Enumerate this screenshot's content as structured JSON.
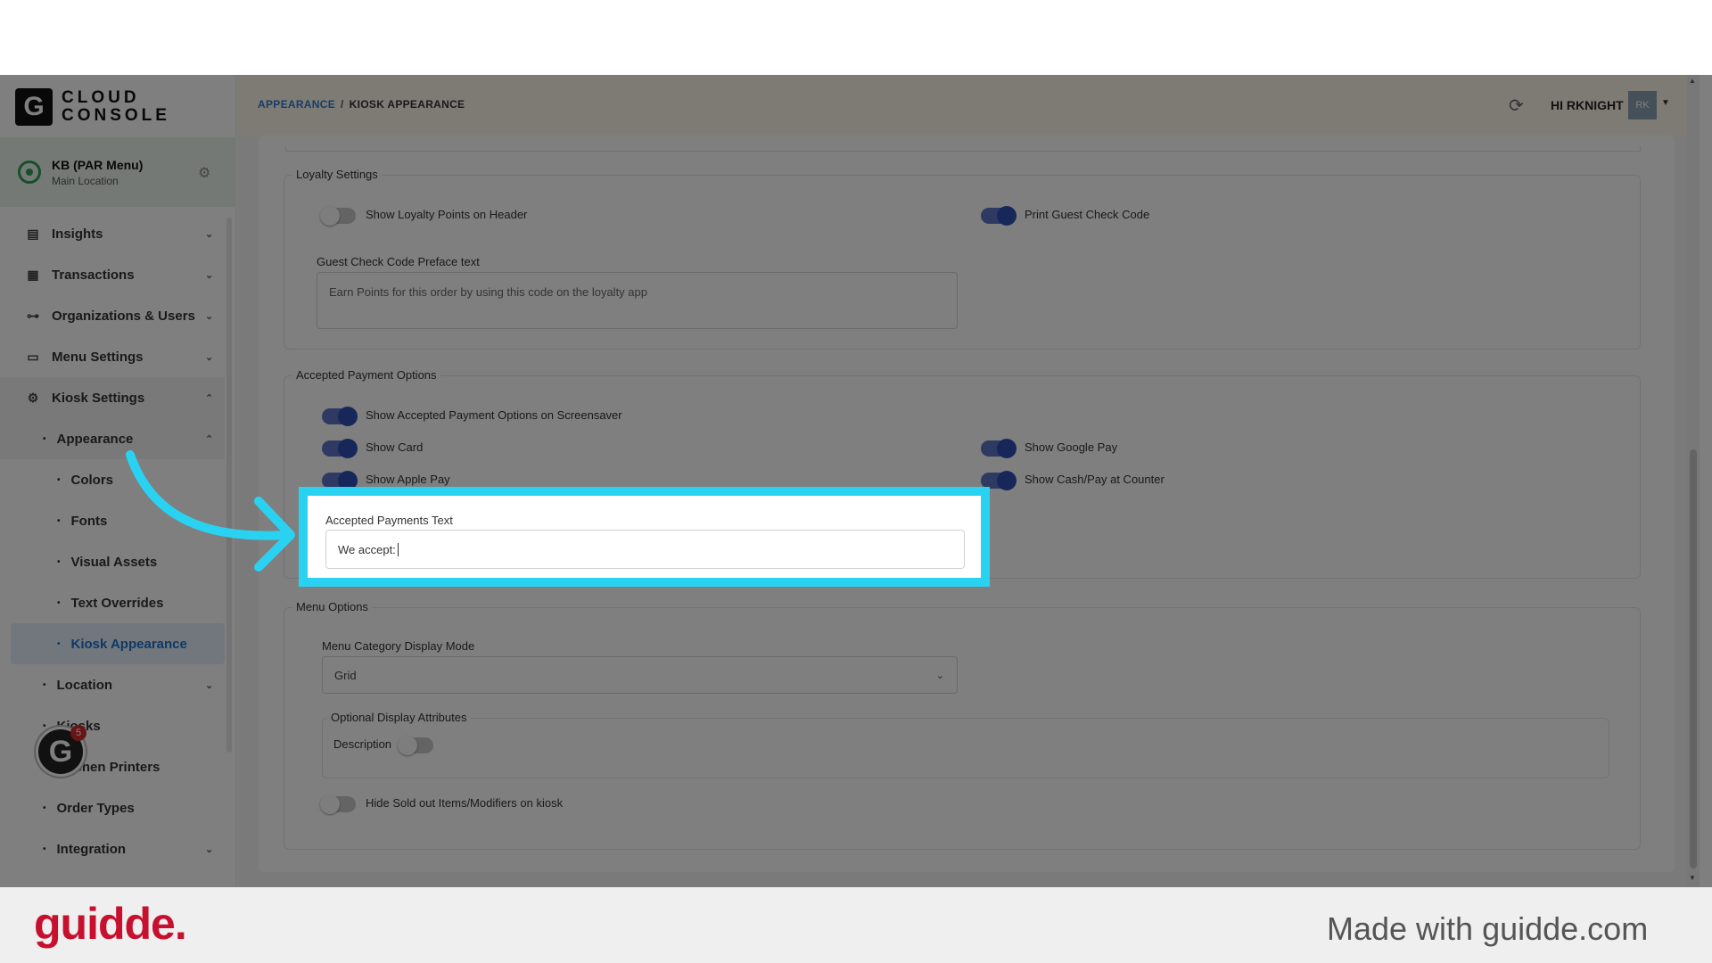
{
  "logo": {
    "letter": "G",
    "line1": "CLOUD",
    "line2": "CONSOLE"
  },
  "location": {
    "name": "KB (PAR Menu)",
    "sub": "Main Location"
  },
  "nav": {
    "items": [
      "Insights",
      "Transactions",
      "Organizations & Users",
      "Menu Settings",
      "Kiosk Settings"
    ],
    "appearance": "Appearance",
    "appearance_children": [
      "Colors",
      "Fonts",
      "Visual Assets",
      "Text Overrides",
      "Kiosk Appearance"
    ],
    "after": [
      "Location",
      "Kiosks",
      "Kitchen Printers",
      "Order Types",
      "Integration"
    ]
  },
  "help": {
    "letter": "G",
    "count": "5"
  },
  "header": {
    "crumb_link": "APPEARANCE",
    "crumb_sep": "/",
    "crumb_current": "KIOSK APPEARANCE",
    "user": "HI RKNIGHT",
    "avatar": "RK"
  },
  "loyalty": {
    "legend": "Loyalty Settings",
    "show_points": {
      "label": "Show Loyalty Points on Header",
      "on": false
    },
    "print_code": {
      "label": "Print Guest Check Code",
      "on": true
    },
    "preface_label": "Guest Check Code Preface text",
    "preface_value": "Earn Points for this order by using this code on the loyalty app"
  },
  "payments": {
    "legend": "Accepted Payment Options",
    "screensaver": {
      "label": "Show Accepted Payment Options on Screensaver",
      "on": true
    },
    "card": {
      "label": "Show Card",
      "on": true
    },
    "google": {
      "label": "Show Google Pay",
      "on": true
    },
    "apple": {
      "label": "Show Apple Pay",
      "on": true
    },
    "cash": {
      "label": "Show Cash/Pay at Counter",
      "on": true
    },
    "text_label": "Accepted Payments Text",
    "text_value": "We accept:"
  },
  "menu": {
    "legend": "Menu Options",
    "mode_label": "Menu Category Display Mode",
    "mode_value": "Grid",
    "attrs_legend": "Optional Display Attributes",
    "description": {
      "label": "Description",
      "on": false
    },
    "hide_sold_out": {
      "label": "Hide Sold out Items/Modifiers on kiosk",
      "on": false
    }
  },
  "footer": {
    "brand": "guidde.",
    "made_with": "Made with guidde.com"
  },
  "colors": {
    "accent": "#2ad2f2",
    "toggle_on": "#2f4fb5",
    "brand": "#c8102e",
    "link": "#2a7bd3"
  }
}
